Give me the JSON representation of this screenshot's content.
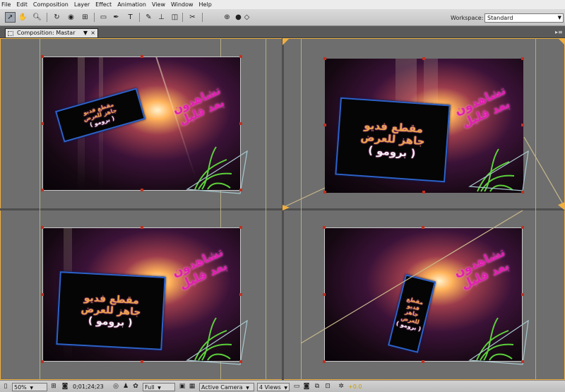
{
  "menu": [
    "File",
    "Edit",
    "Composition",
    "Layer",
    "Effect",
    "Animation",
    "View",
    "Window",
    "Help"
  ],
  "toolbar": {
    "tools": [
      "selection-tool",
      "hand-tool",
      "zoom-tool",
      "rotation-tool",
      "orbit-camera-tool",
      "pan-behind-tool",
      "rectangle-mask-tool",
      "pen-tool",
      "type-tool",
      "brush-tool",
      "clone-stamp-tool",
      "eraser-tool",
      "puppet-pin-tool",
      "axis-mode-tool"
    ],
    "workspace_label": "Workspace:",
    "workspace_value": "Standard"
  },
  "panel": {
    "tab_label": "Composition: Mastar"
  },
  "viewer": {
    "card_line1": "مقطع فديو",
    "card_line2": "جاهز للعرض",
    "card_line3": "( برومو )",
    "pink_line1": "تشاهدون",
    "pink_line2": "بعد قليل"
  },
  "statusbar": {
    "magnification": "50%",
    "timecode": "0;01;24;23",
    "resolution": "Full",
    "view": "Active Camera",
    "views": "4 Views",
    "exposure": "+0.0"
  }
}
